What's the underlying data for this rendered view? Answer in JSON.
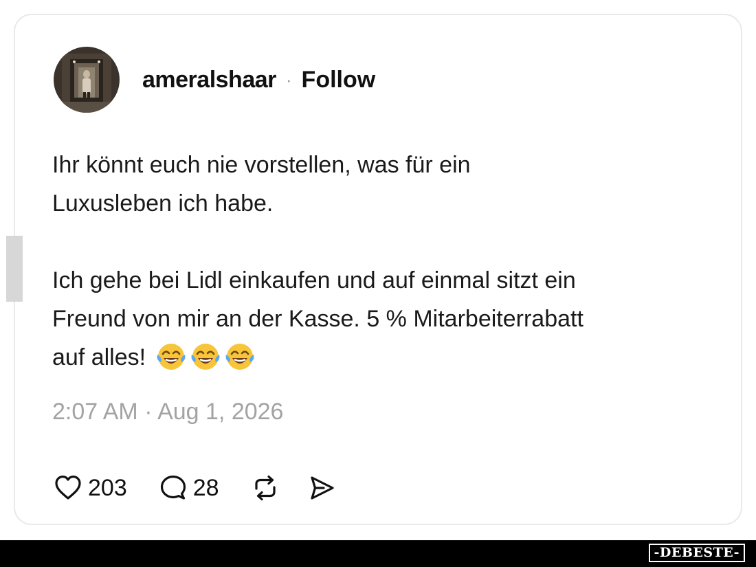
{
  "post": {
    "username": "ameralshaar",
    "separator": "·",
    "follow_label": "Follow",
    "text_lines_p1": [
      "Ihr könnt euch nie vorstellen, was für ein",
      "Luxusleben ich habe."
    ],
    "text_lines_p2": [
      "Ich gehe bei Lidl einkaufen und auf einmal sitzt ein",
      "Freund von mir an der Kasse. 5 % Mitarbeiterrabatt",
      "auf alles!"
    ],
    "emojis": [
      "face-with-tears-of-joy-icon",
      "face-with-tears-of-joy-icon",
      "face-with-tears-of-joy-icon"
    ],
    "timestamp": "2:07 AM · Aug 1, 2026"
  },
  "actions": {
    "likes": "203",
    "replies": "28"
  },
  "watermark": {
    "logo": "-DEBESTE-"
  }
}
